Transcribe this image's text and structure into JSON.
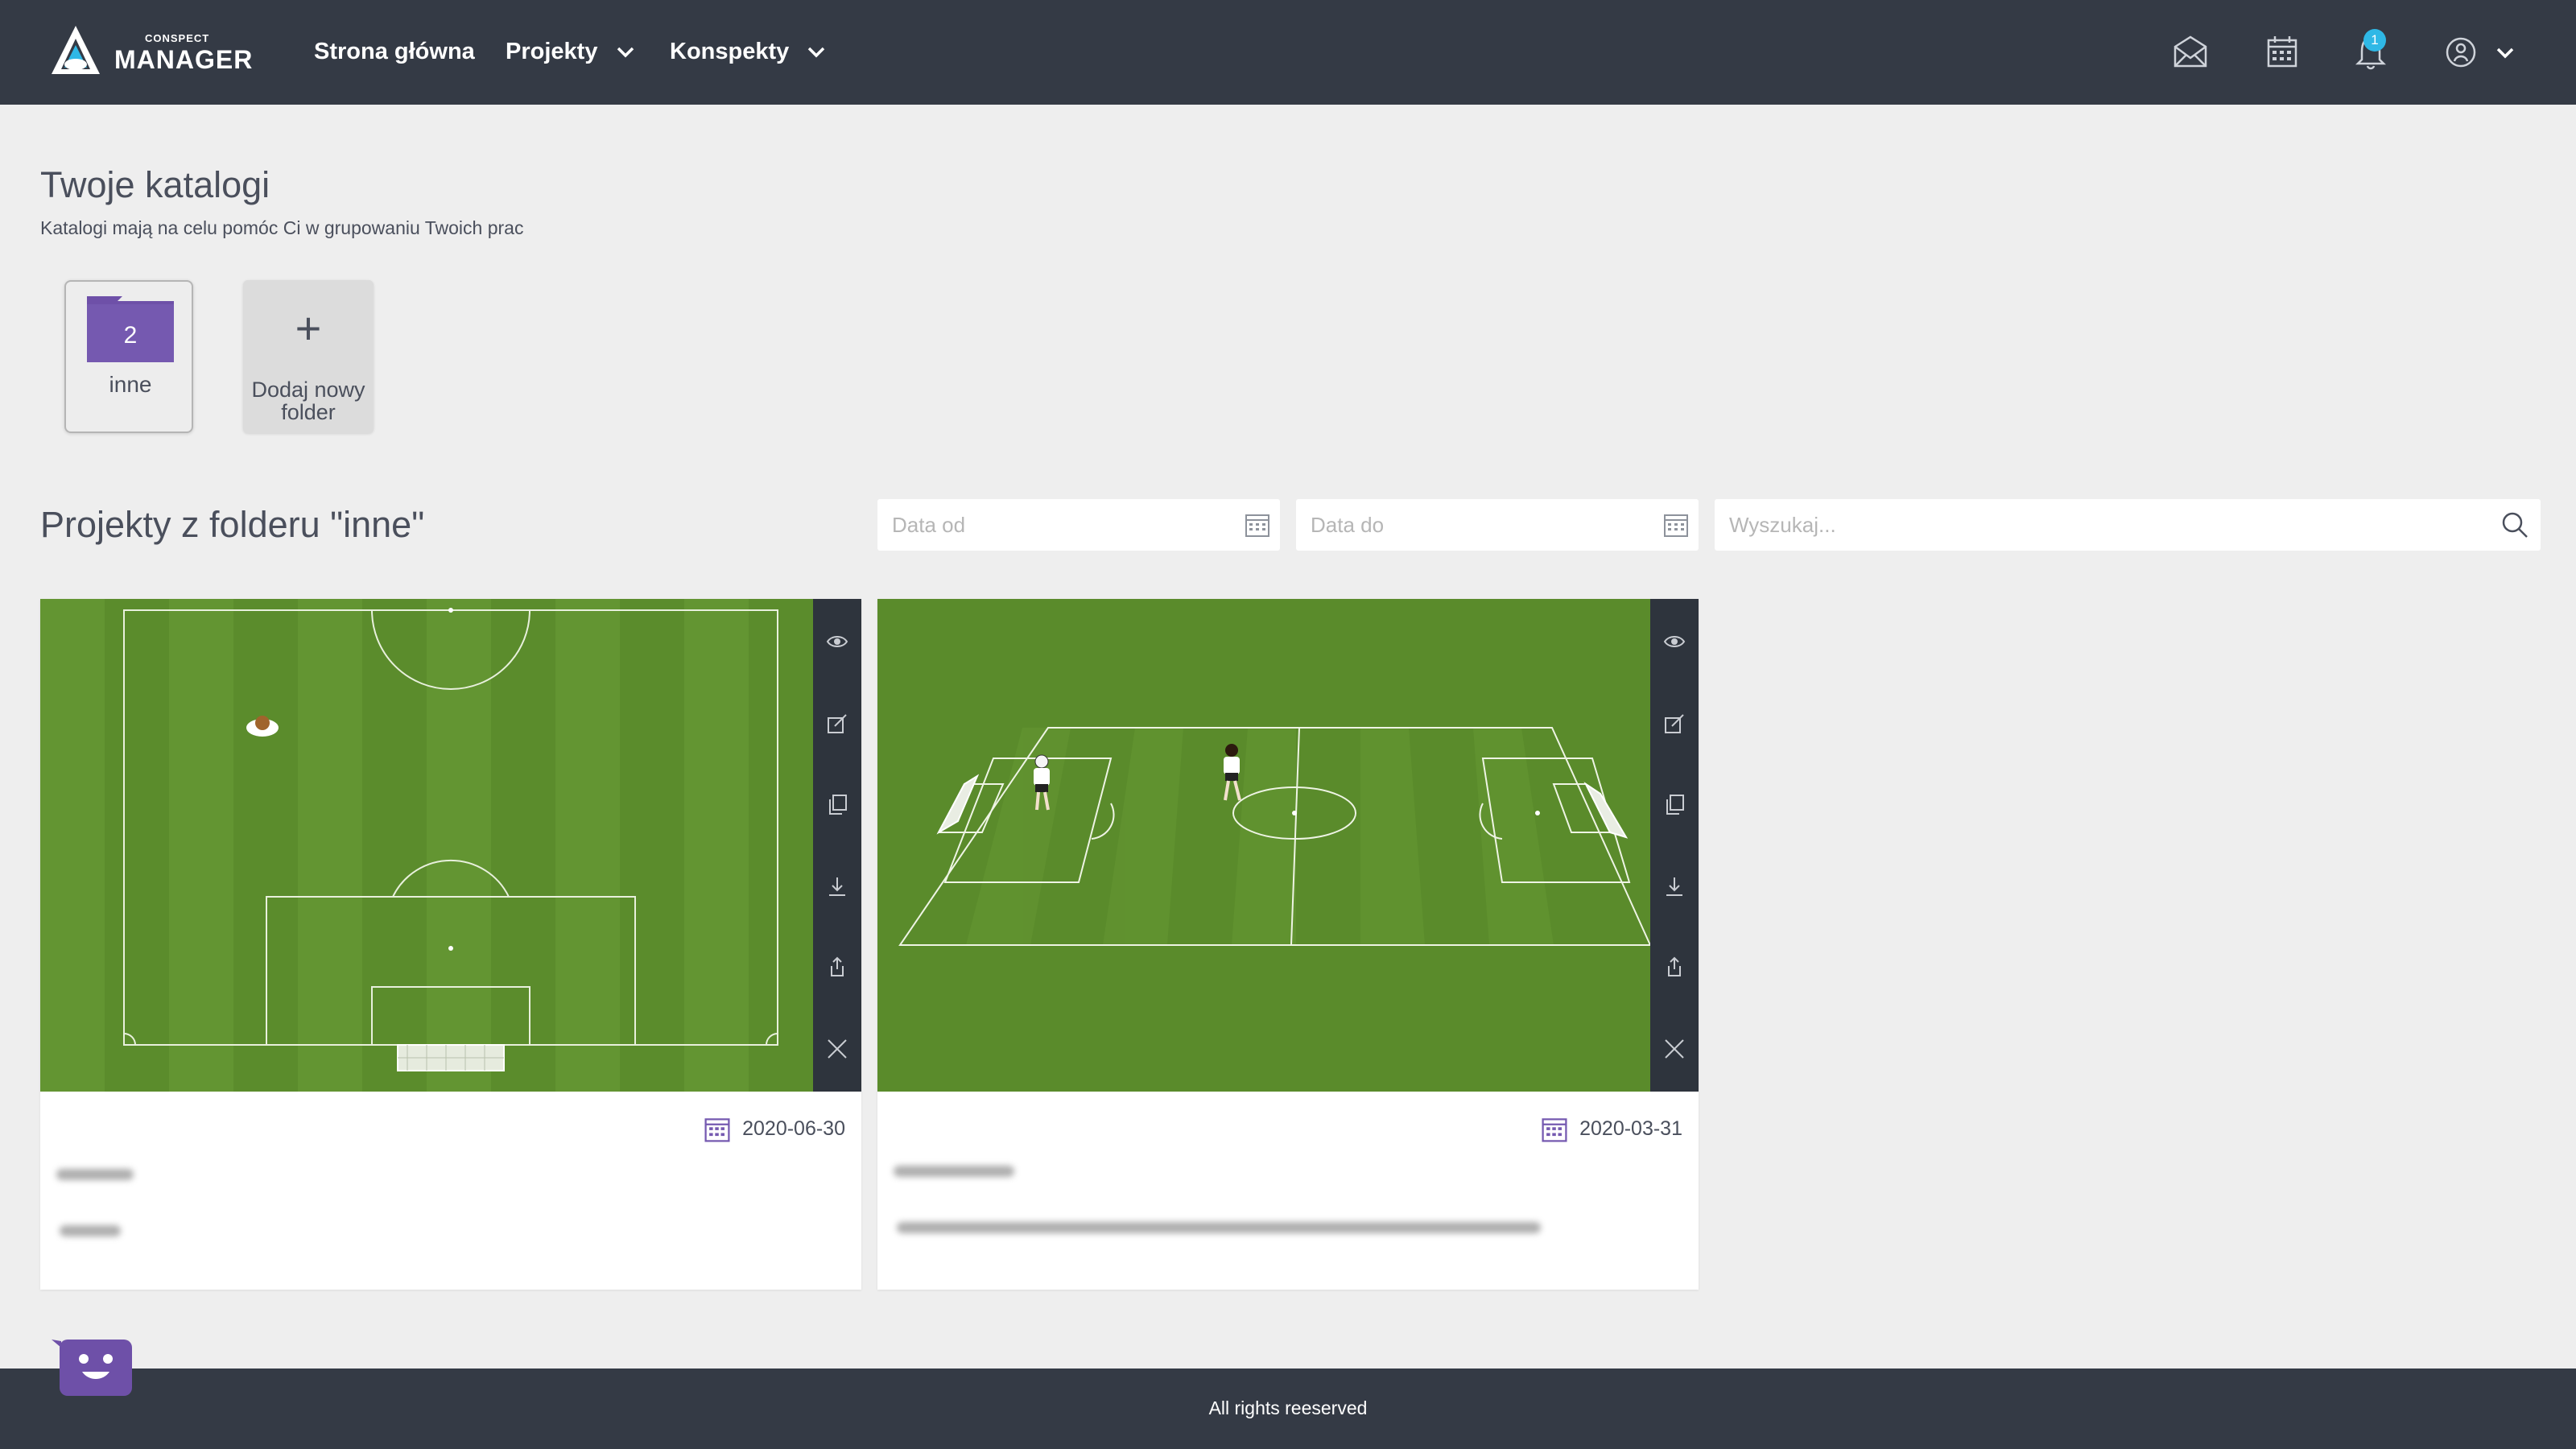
{
  "brand": {
    "small": "CONSPECT",
    "big": "MANAGER"
  },
  "nav": {
    "home": "Strona główna",
    "projects": "Projekty",
    "conspects": "Konspekty"
  },
  "notifications": {
    "count": "1"
  },
  "catalogs": {
    "title": "Twoje katalogi",
    "subtitle": "Katalogi mają na celu pomóc Ci w grupowaniu Twoich prac",
    "folders": [
      {
        "name": "inne",
        "count": "2"
      }
    ],
    "add_label": "Dodaj nowy folder"
  },
  "projects": {
    "title": "Projekty z folderu \"inne\"",
    "date_from_placeholder": "Data od",
    "date_to_placeholder": "Data do",
    "search_placeholder": "Wyszukaj...",
    "items": [
      {
        "date": "2020-06-30"
      },
      {
        "date": "2020-03-31"
      }
    ]
  },
  "footer": {
    "text": "All rights reeserved"
  },
  "colors": {
    "header": "#343a45",
    "accent_purple": "#6e50a8",
    "pitch": "#5b8c2c",
    "badge": "#2fb8e6"
  }
}
